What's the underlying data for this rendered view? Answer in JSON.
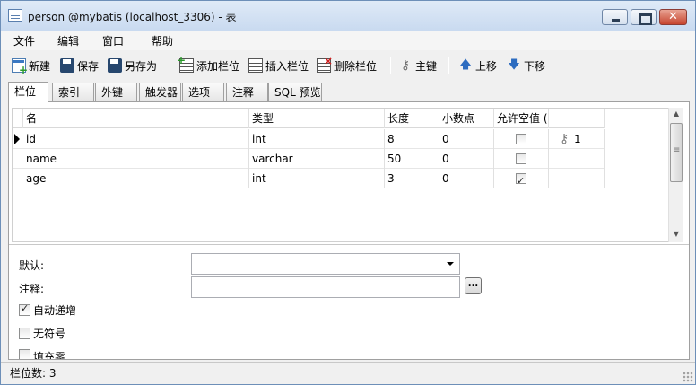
{
  "window": {
    "title": "person @mybatis (localhost_3306) - 表",
    "close_glyph": "✕"
  },
  "menu": {
    "items": [
      "文件",
      "编辑",
      "窗口",
      "帮助"
    ]
  },
  "toolbar": {
    "new_label": "新建",
    "save_label": "保存",
    "save_as_label": "另存为",
    "add_field_label": "添加栏位",
    "insert_field_label": "插入栏位",
    "delete_field_label": "删除栏位",
    "primary_key_label": "主键",
    "move_up_label": "上移",
    "move_down_label": "下移"
  },
  "tabs": [
    "栏位",
    "索引",
    "外键",
    "触发器",
    "选项",
    "注释",
    "SQL 预览"
  ],
  "active_tab": "栏位",
  "grid": {
    "columns": [
      "名",
      "类型",
      "长度",
      "小数点",
      "允许空值 (",
      ""
    ],
    "rows": [
      {
        "name": "id",
        "type": "int",
        "length": "8",
        "decimals": "0",
        "nullable": false,
        "key": "1",
        "selected": true
      },
      {
        "name": "name",
        "type": "varchar",
        "length": "50",
        "decimals": "0",
        "nullable": false,
        "key": "",
        "selected": false
      },
      {
        "name": "age",
        "type": "int",
        "length": "3",
        "decimals": "0",
        "nullable": true,
        "key": "",
        "selected": false
      }
    ]
  },
  "form": {
    "default_label": "默认:",
    "default_value": "",
    "comment_label": "注释:",
    "comment_value": "",
    "ellipsis": "...",
    "options": [
      {
        "label": "自动递增",
        "checked": true
      },
      {
        "label": "无符号",
        "checked": false
      },
      {
        "label": "填充零",
        "checked": false
      }
    ]
  },
  "status": {
    "text": "栏位数: 3"
  }
}
